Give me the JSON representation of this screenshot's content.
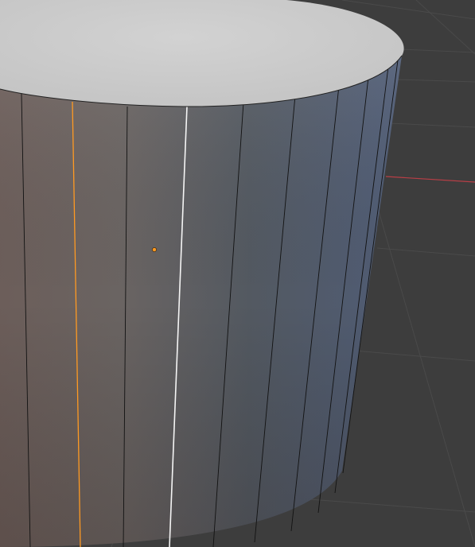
{
  "app": {
    "name": "3D Viewport",
    "mode": "edit-mode"
  },
  "viewport": {
    "background_color": "#3d3d3d",
    "grid_line_color": "#4d4d4d",
    "x_axis_color": "#b83e46"
  },
  "object": {
    "type": "cylinder",
    "top_cap_color": "#cdcdcd",
    "edge_color": "#111111",
    "selected_edge_color": "#ff9a22",
    "active_edge_color": "#ffffff",
    "face_dot_color": "#ff9a22"
  }
}
